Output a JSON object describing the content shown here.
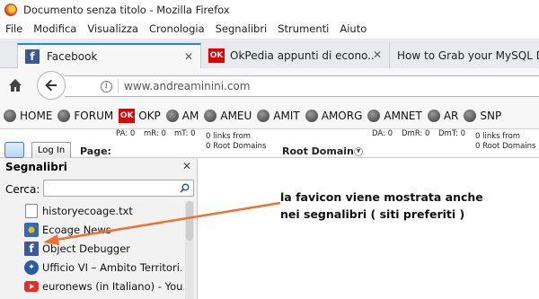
{
  "window": {
    "title": "Documento senza titolo - Mozilla Firefox"
  },
  "menu": [
    "File",
    "Modifica",
    "Visualizza",
    "Cronologia",
    "Segnalibri",
    "Strumenti",
    "Aiuto"
  ],
  "tabs": [
    {
      "label": "Facebook",
      "icon": "facebook-icon"
    },
    {
      "label": "OkPedia appunti di econo...",
      "icon": "ok-icon"
    },
    {
      "label": "How to Grab your MySQL Dat"
    }
  ],
  "tab_icon_text": {
    "facebook": "f",
    "ok": "OK"
  },
  "url": {
    "value": "www.andreaminini.com",
    "info": "i"
  },
  "bookmarks_toolbar": [
    "HOME",
    "FORUM",
    "OKP",
    "AM",
    "AMEU",
    "AMIT",
    "AMORG",
    "AMNET",
    "AR",
    "SNP"
  ],
  "seo_bar": {
    "pa": "PA: 0",
    "mr": "mR: 0",
    "mt": "mT: 0",
    "links_from_1": "0 links from",
    "root_domains_1": "0 Root Domains",
    "root_domain_label": "Root Domain",
    "da": "DA: 0",
    "dmr": "DmR: 0",
    "dmt": "DmT: 0",
    "links_from_2": "0 links from",
    "root_domains_2": "0 Root Domains",
    "login": "Log In",
    "page_label": "Page:"
  },
  "sidebar": {
    "title": "Segnalibri",
    "search_label": "Cerca:",
    "search_value": "",
    "items": [
      {
        "label": "historyecoage.txt",
        "icon": "document-icon"
      },
      {
        "label": "Ecoage News",
        "icon": "ecoage-icon"
      },
      {
        "label": "Object Debugger",
        "icon": "facebook-icon"
      },
      {
        "label": "Ufficio VI – Ambito Territori...",
        "icon": "government-icon"
      },
      {
        "label": "euronews (in Italiano) - You...",
        "icon": "youtube-icon"
      }
    ]
  },
  "annotation": {
    "line1": "la favicon viene mostrata anche",
    "line2": "nei segnalibri ( siti preferiti )",
    "color": "#f07030"
  },
  "colors": {
    "tab_accent": "#1e88e5",
    "facebook": "#3b5998",
    "ok": "#e00000"
  }
}
